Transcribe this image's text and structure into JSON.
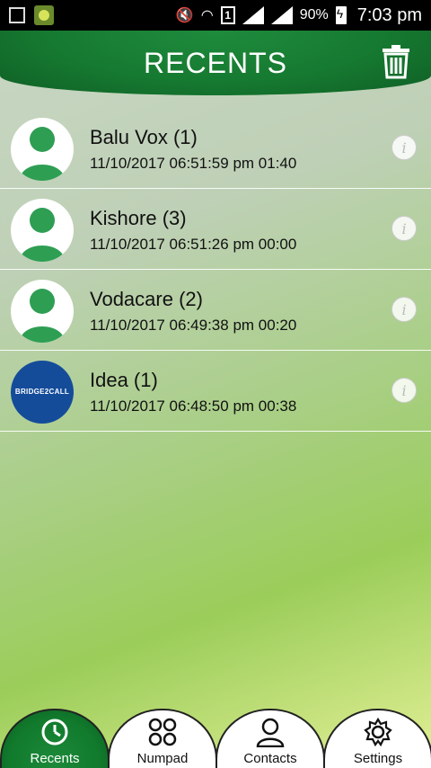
{
  "status_bar": {
    "battery": "90%",
    "sim": "1",
    "time": "7:03 pm"
  },
  "header": {
    "title": "RECENTS"
  },
  "recents": [
    {
      "name": "Balu Vox (1)",
      "details": "11/10/2017 06:51:59 pm 01:40",
      "avatar": "person"
    },
    {
      "name": "Kishore (3)",
      "details": "11/10/2017 06:51:26 pm 00:00",
      "avatar": "person"
    },
    {
      "name": "Vodacare (2)",
      "details": "11/10/2017 06:49:38 pm 00:20",
      "avatar": "person"
    },
    {
      "name": "Idea (1)",
      "details": "11/10/2017 06:48:50 pm 00:38",
      "avatar": "logo",
      "logo_text": "BRIDGE2CALL"
    }
  ],
  "tabs": [
    {
      "label": "Recents",
      "icon": "clock-icon",
      "active": true
    },
    {
      "label": "Numpad",
      "icon": "numpad-icon",
      "active": false
    },
    {
      "label": "Contacts",
      "icon": "person-icon",
      "active": false
    },
    {
      "label": "Settings",
      "icon": "gear-icon",
      "active": false
    }
  ],
  "colors": {
    "accent_green": "#167a31",
    "logo_blue": "#144c9a"
  }
}
